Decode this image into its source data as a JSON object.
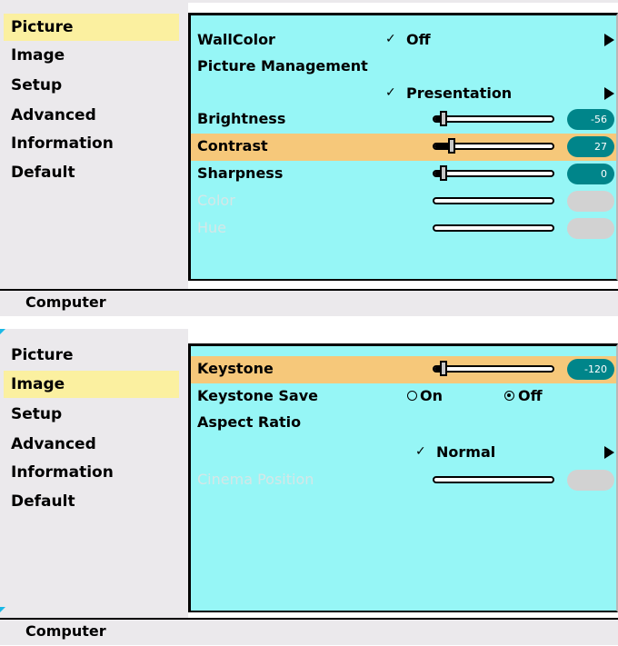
{
  "sidebar_items": [
    "Picture",
    "Image",
    "Setup",
    "Advanced",
    "Information",
    "Default"
  ],
  "status_text": "Computer",
  "picture_menu": {
    "wallcolor": {
      "label": "WallColor",
      "value": "Off"
    },
    "picture_management": {
      "label": "Picture Management",
      "value": "Presentation"
    },
    "brightness": {
      "label": "Brightness",
      "value": "-56",
      "level": 0.06
    },
    "contrast": {
      "label": "Contrast",
      "value": "27",
      "level": 0.13
    },
    "sharpness": {
      "label": "Sharpness",
      "value": "0",
      "level": 0.06
    },
    "color": {
      "label": "Color"
    },
    "hue": {
      "label": "Hue"
    }
  },
  "image_menu": {
    "keystone": {
      "label": "Keystone",
      "value": "-120",
      "level": 0.06
    },
    "keystone_save": {
      "label": "Keystone Save",
      "on_label": "On",
      "off_label": "Off",
      "selected": "Off"
    },
    "aspect_ratio": {
      "label": "Aspect Ratio",
      "value": "Normal"
    },
    "cinema_position": {
      "label": "Cinema Position"
    }
  },
  "colors": {
    "panel": "#96f6f6",
    "highlight": "#f6c87a",
    "selected": "#fbf0a0",
    "badge": "#00858a"
  }
}
